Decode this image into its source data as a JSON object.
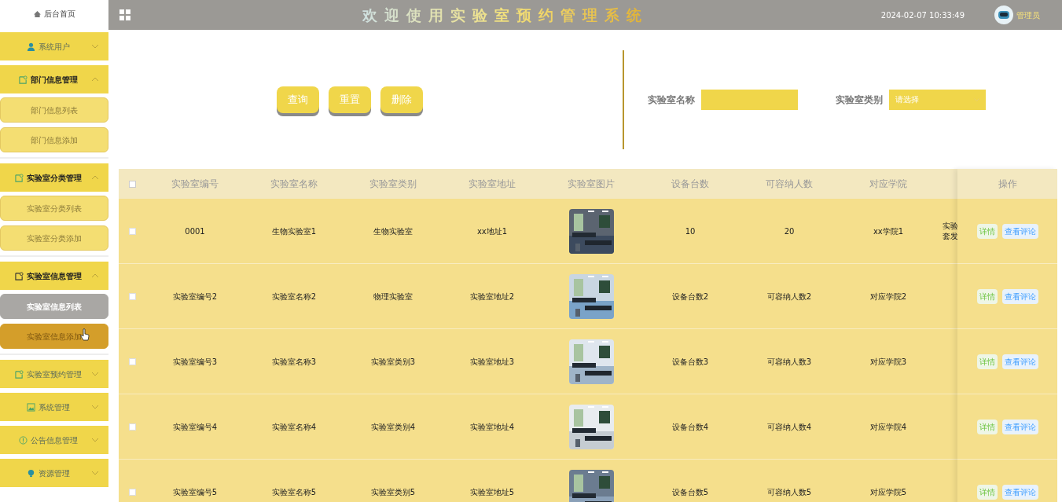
{
  "sidebar": {
    "home": "后台首页",
    "groups": [
      {
        "label": "系统用户",
        "expanded": false
      },
      {
        "label": "部门信息管理",
        "expanded": true,
        "items": [
          {
            "label": "部门信息列表",
            "selected": false,
            "hovered": false
          },
          {
            "label": "部门信息添加",
            "selected": false,
            "hovered": false
          }
        ]
      },
      {
        "label": "实验室分类管理",
        "expanded": true,
        "items": [
          {
            "label": "实验室分类列表",
            "selected": false,
            "hovered": false
          },
          {
            "label": "实验室分类添加",
            "selected": false,
            "hovered": false
          }
        ]
      },
      {
        "label": "实验室信息管理",
        "expanded": true,
        "items": [
          {
            "label": "实验室信息列表",
            "selected": true,
            "hovered": false
          },
          {
            "label": "实验室信息添加",
            "selected": false,
            "hovered": true
          }
        ]
      },
      {
        "label": "实验室预约管理",
        "expanded": false
      },
      {
        "label": "系统管理",
        "expanded": false
      },
      {
        "label": "公告信息管理",
        "expanded": false
      },
      {
        "label": "资源管理",
        "expanded": false
      }
    ]
  },
  "header": {
    "title": "欢迎使用实验室预约管理系统",
    "datetime": "2024-02-07 10:33:49",
    "user": "管理员"
  },
  "toolbar": {
    "buttons": [
      "查询",
      "重置",
      "删除"
    ]
  },
  "filters": [
    {
      "label": "实验室名称",
      "kind": "text"
    },
    {
      "label": "实验室类别",
      "kind": "select",
      "placeholder": "请选择"
    }
  ],
  "table": {
    "columns": [
      "实验室编号",
      "实验室名称",
      "实验室类别",
      "实验室地址",
      "实验室图片",
      "设备台数",
      "可容纳人数",
      "对应学院"
    ],
    "action_column": "操作",
    "all_checked": false,
    "rows": [
      {
        "checked": false,
        "cells": [
          "0001",
          "生物实验室1",
          "生物实验室",
          "xx地址1",
          "",
          "10",
          "20",
          "xx学院1"
        ],
        "cut_text": [
          "实验",
          "套发"
        ],
        "actions": [
          "详情",
          "查看评论"
        ]
      },
      {
        "checked": false,
        "cells": [
          "实验室编号2",
          "实验室名称2",
          "物理实验室",
          "实验室地址2",
          "",
          "设备台数2",
          "可容纳人数2",
          "对应学院2"
        ],
        "actions": [
          "详情",
          "查看评论"
        ]
      },
      {
        "checked": false,
        "cells": [
          "实验室编号3",
          "实验室名称3",
          "实验室类别3",
          "实验室地址3",
          "",
          "设备台数3",
          "可容纳人数3",
          "对应学院3"
        ],
        "actions": [
          "详情",
          "查看评论"
        ]
      },
      {
        "checked": false,
        "cells": [
          "实验室编号4",
          "实验室名称4",
          "实验室类别4",
          "实验室地址4",
          "",
          "设备台数4",
          "可容纳人数4",
          "对应学院4"
        ],
        "actions": [
          "详情",
          "查看评论"
        ]
      },
      {
        "checked": false,
        "cells": [
          "实验室编号5",
          "实验室名称5",
          "实验室类别5",
          "实验室地址5",
          "",
          "设备台数5",
          "可容纳人数5",
          "对应学院5"
        ],
        "actions": [
          "详情",
          "查看评论"
        ]
      }
    ]
  }
}
